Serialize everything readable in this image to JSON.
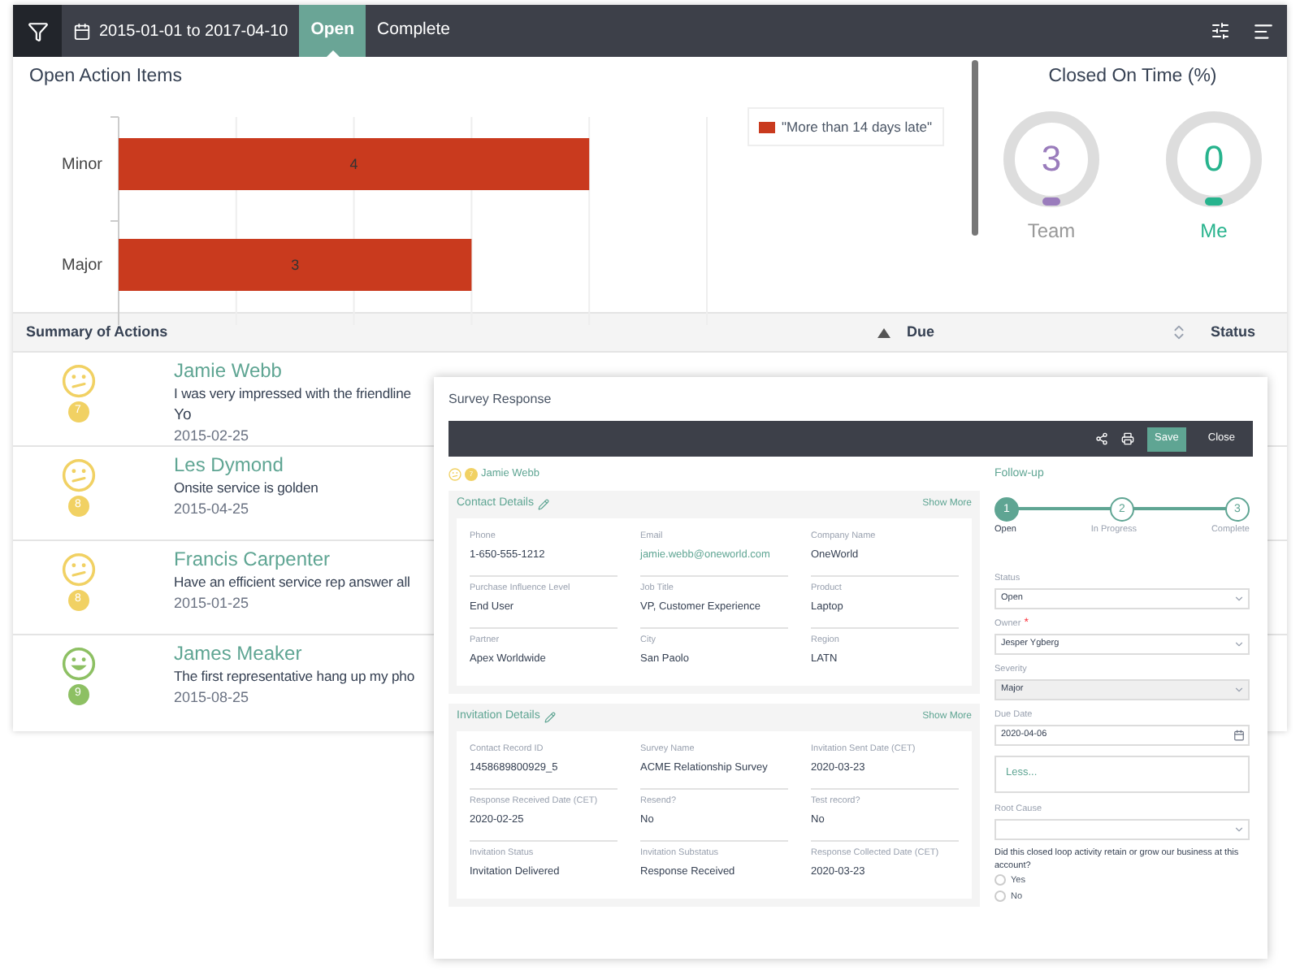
{
  "toolbar": {
    "date_range": "2015-01-01 to 2017-04-10",
    "tabs": [
      {
        "label": "Open",
        "selected": true
      },
      {
        "label": "Complete",
        "selected": false
      }
    ]
  },
  "chart_panel": {
    "chart_data": {
      "type": "bar",
      "title": "Open Action Items",
      "orientation": "horizontal",
      "categories": [
        "Minor",
        "Major"
      ],
      "series": [
        {
          "name": "\"More than 14 days late\"",
          "color": "#c93a1e",
          "values": [
            4,
            3
          ]
        }
      ],
      "xlim": [
        0,
        5
      ],
      "data_labels": true
    }
  },
  "closed_on_time": {
    "title": "Closed On Time (%)",
    "gauges": [
      {
        "value": "3",
        "label": "Team",
        "color": "#9a7cbc"
      },
      {
        "value": "0",
        "label": "Me",
        "color": "#27b38d"
      }
    ]
  },
  "table": {
    "columns": [
      {
        "label": "Summary of Actions",
        "kind": "sorted_ascending"
      },
      {
        "label": "Due",
        "kind": "sortable"
      },
      {
        "label": "Status",
        "kind": "plain"
      }
    ],
    "rows": [
      {
        "kind": "neutral",
        "score": "7",
        "color": "#f1d163",
        "name": "Jamie Webb",
        "comment": "I was very impressed with the friendline",
        "extra": "Yo",
        "date": "2015-02-25"
      },
      {
        "kind": "neutral",
        "score": "8",
        "color": "#f1d163",
        "name": "Les Dymond",
        "comment": "Onsite service is golden",
        "date": "2015-04-25"
      },
      {
        "kind": "neutral",
        "score": "8",
        "color": "#f1d163",
        "name": "Francis Carpenter",
        "comment": "Have an efficient service rep answer all",
        "date": "2015-01-25"
      },
      {
        "kind": "happy",
        "score": "9",
        "color": "#8dc063",
        "name": "James Meaker",
        "comment": "The first representative hang up my pho",
        "date": "2015-08-25"
      }
    ]
  },
  "modal": {
    "title": "Survey Response",
    "buttons": [
      "Save",
      "Close"
    ],
    "respondent": {
      "score": "7",
      "name": "Jamie Webb"
    },
    "sections": [
      {
        "title": "Contact Details",
        "action": "Show More",
        "fields": [
          {
            "label": "Phone",
            "value": "1-650-555-1212",
            "kind": "text"
          },
          {
            "label": "Email",
            "value": "jamie.webb@oneworld.com",
            "kind": "link"
          },
          {
            "label": "Company Name",
            "value": "OneWorld",
            "kind": "text"
          },
          {
            "label": "Purchase Influence Level",
            "value": "End User",
            "kind": "text"
          },
          {
            "label": "Job Title",
            "value": "VP, Customer Experience",
            "kind": "text"
          },
          {
            "label": "Product",
            "value": "Laptop",
            "kind": "text"
          },
          {
            "label": "Partner",
            "value": "Apex Worldwide",
            "kind": "text"
          },
          {
            "label": "City",
            "value": "San Paolo",
            "kind": "text"
          },
          {
            "label": "Region",
            "value": "LATN",
            "kind": "text"
          }
        ]
      },
      {
        "title": "Invitation Details",
        "action": "Show More",
        "fields": [
          {
            "label": "Contact Record ID",
            "value": "1458689800929_5",
            "kind": "text"
          },
          {
            "label": "Survey Name",
            "value": "ACME Relationship Survey",
            "kind": "text"
          },
          {
            "label": "Invitation Sent Date (CET)",
            "value": "2020-03-23",
            "kind": "text"
          },
          {
            "label": "Response Received Date (CET)",
            "value": "2020-02-25",
            "kind": "text"
          },
          {
            "label": "Resend?",
            "value": "No",
            "kind": "text"
          },
          {
            "label": "Test record?",
            "value": "No",
            "kind": "text"
          },
          {
            "label": "Invitation Status",
            "value": "Invitation Delivered",
            "kind": "text"
          },
          {
            "label": "Invitation Substatus",
            "value": "Response Received",
            "kind": "text"
          },
          {
            "label": "Response Collected Date (CET)",
            "value": "2020-03-23",
            "kind": "text"
          }
        ]
      }
    ],
    "follow_up": {
      "title": "Follow-up",
      "steps": [
        {
          "number": "1",
          "label": "Open",
          "selected": true
        },
        {
          "number": "2",
          "label": "In Progress",
          "selected": false
        },
        {
          "number": "3",
          "label": "Complete",
          "selected": false
        }
      ],
      "fields": [
        {
          "kind": "select",
          "label": "Status",
          "value": "Open",
          "disabled": false
        },
        {
          "kind": "select",
          "label": "Owner",
          "marker": "*",
          "value": "Jesper Ygberg",
          "disabled": false
        },
        {
          "kind": "select",
          "label": "Severity",
          "value": "Major",
          "disabled": true
        },
        {
          "kind": "date",
          "label": "Due Date",
          "value": "2020-04-06",
          "disabled": false
        },
        {
          "kind": "link_box",
          "value": "Less..."
        },
        {
          "kind": "select",
          "label": "Root Cause",
          "disabled": false
        },
        {
          "kind": "question",
          "label": "Did this closed loop activity retain or grow our business at this account?",
          "options": [
            {
              "label": "Yes",
              "selected": false
            },
            {
              "label": "No",
              "selected": false
            }
          ]
        }
      ]
    }
  }
}
